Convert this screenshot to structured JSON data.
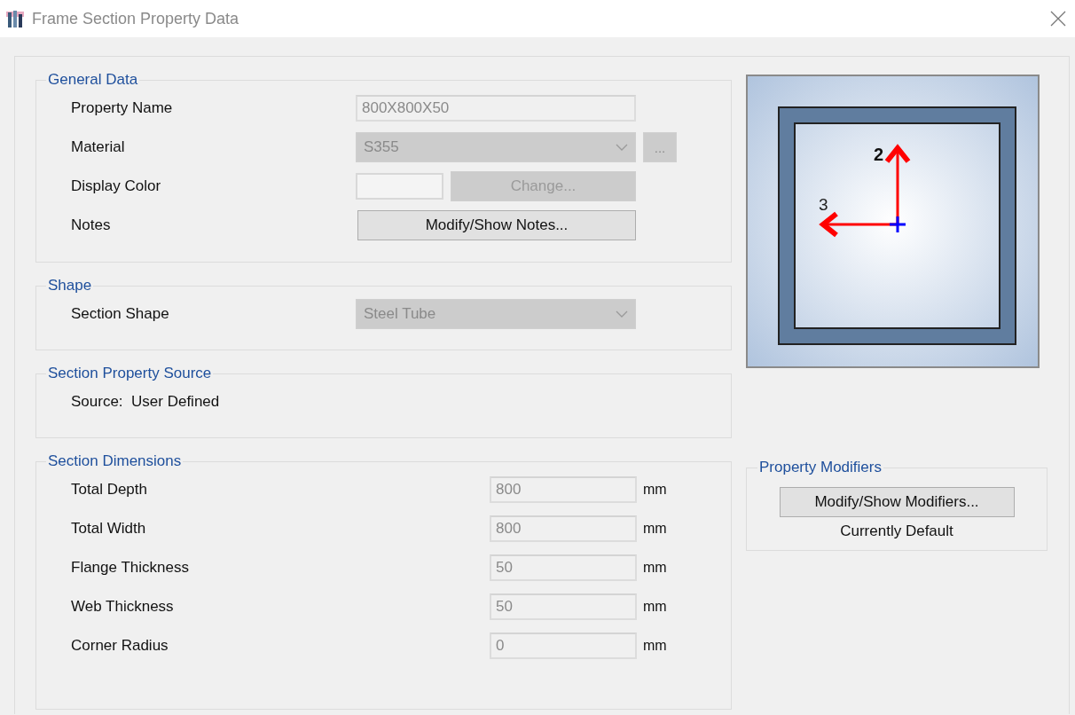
{
  "window": {
    "title": "Frame Section Property Data"
  },
  "general_data": {
    "title": "General Data",
    "rows": [
      {
        "kind": "text",
        "label": "Property Name",
        "value": "800X800X50"
      },
      {
        "kind": "dropdown",
        "label": "Material",
        "value": "S355",
        "extra": "..."
      },
      {
        "kind": "color",
        "label": "Display Color",
        "button": "Change..."
      },
      {
        "kind": "button",
        "label": "Notes",
        "button": "Modify/Show Notes..."
      }
    ]
  },
  "shape": {
    "title": "Shape",
    "rows": [
      {
        "kind": "dropdown",
        "label": "Section Shape",
        "value": "Steel Tube"
      }
    ]
  },
  "section_property_source": {
    "title": "Section Property Source",
    "text": "Source:  User Defined"
  },
  "section_dimensions": {
    "title": "Section Dimensions",
    "rows": [
      {
        "label": "Total Depth",
        "value": "800",
        "unit": "mm"
      },
      {
        "label": "Total Width",
        "value": "800",
        "unit": "mm"
      },
      {
        "label": "Flange Thickness",
        "value": "50",
        "unit": "mm"
      },
      {
        "label": "Web Thickness",
        "value": "50",
        "unit": "mm"
      },
      {
        "label": "Corner Radius",
        "value": "0",
        "unit": "mm"
      }
    ]
  },
  "section_preview": {
    "axes": [
      "2",
      "3"
    ]
  },
  "property_modifiers": {
    "title": "Property Modifiers",
    "button": "Modify/Show Modifiers...",
    "status": "Currently Default"
  }
}
